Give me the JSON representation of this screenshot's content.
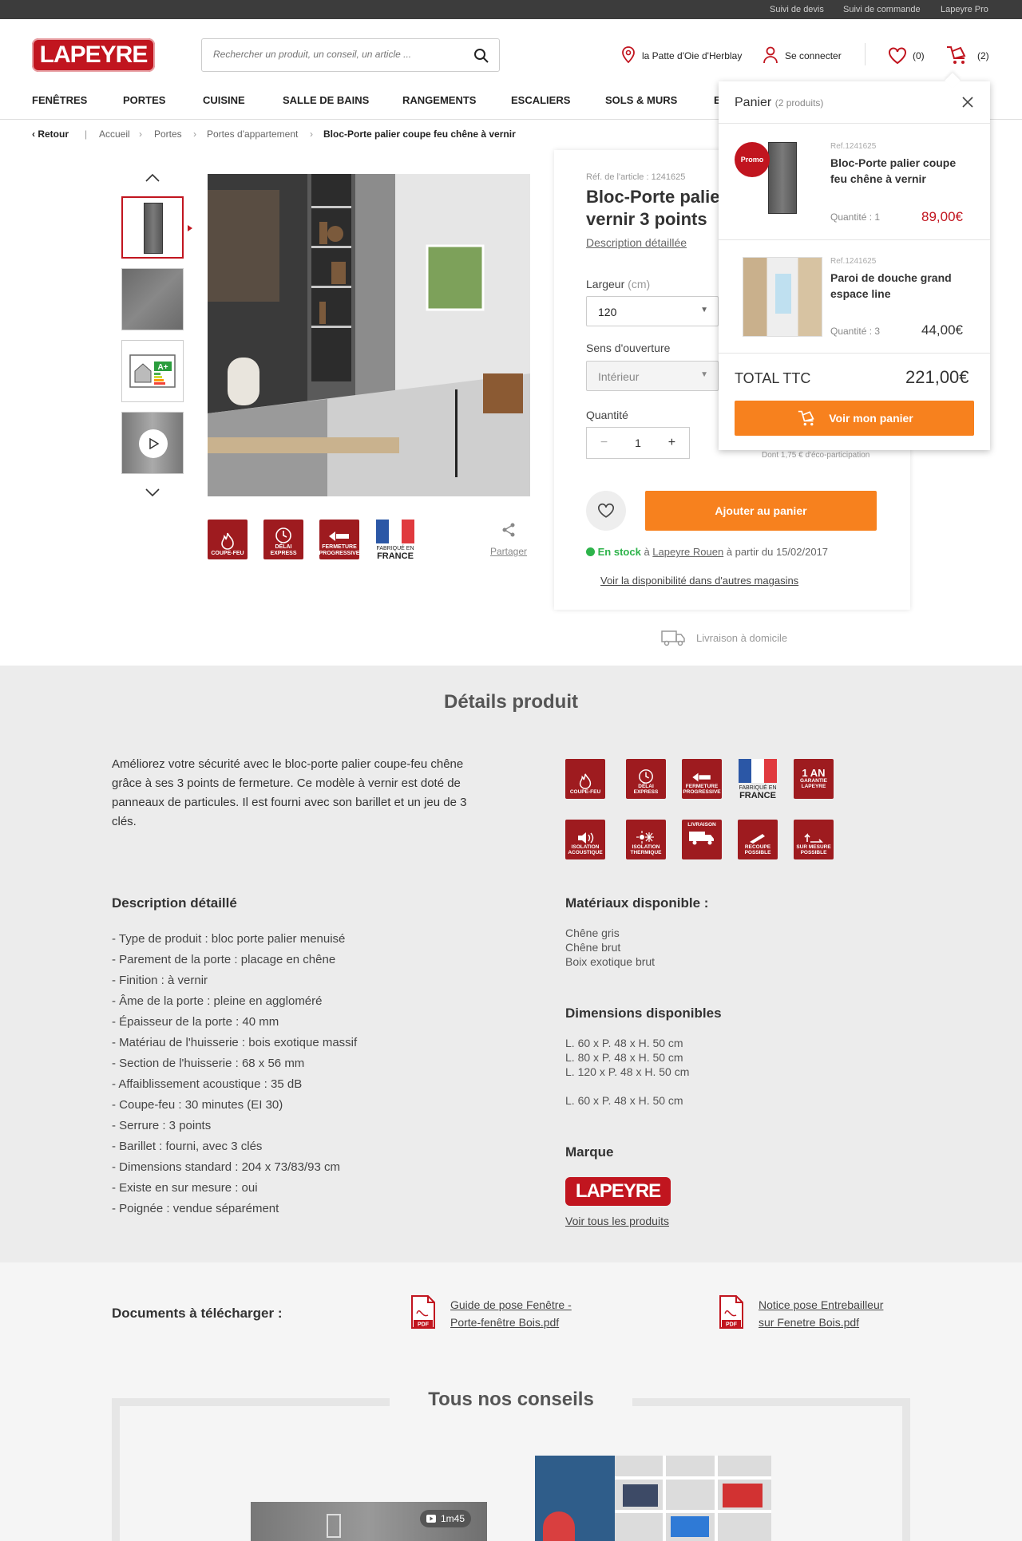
{
  "topbar": {
    "links": [
      "Suivi de devis",
      "Suivi de commande",
      "Lapeyre Pro"
    ]
  },
  "header": {
    "logo": "LAPEYRE",
    "search_placeholder": "Rechercher un produit, un conseil, un article ...",
    "store": "la Patte d'Oie d'Herblay",
    "login": "Se connecter",
    "wishlist_count": "(0)",
    "cart_count": "(2)"
  },
  "nav": [
    "FENÊTRES",
    "PORTES",
    "CUISINE",
    "SALLE DE BAINS",
    "RANGEMENTS",
    "ESCALIERS",
    "SOLS & MURS",
    "E"
  ],
  "breadcrumb": {
    "back": "Retour",
    "items": [
      "Accueil",
      "Portes",
      "Portes d'appartement"
    ],
    "current": "Bloc-Porte palier coupe feu chêne à vernir"
  },
  "product": {
    "ref": "Réf. de l'article : 1241625",
    "title_line1": "Bloc-Porte palier",
    "title_line2": "vernir 3 points",
    "desc_link": "Description détaillée",
    "largeur_label": "Largeur",
    "largeur_unit": "(cm)",
    "largeur_value": "120",
    "sens_label": "Sens d'ouverture",
    "sens_value": "Intérieur",
    "quantite_label": "Quantité",
    "quantite_value": "1",
    "eco": "Dont 1,75 € d'éco-participation",
    "add_to_cart": "Ajouter au panier",
    "stock_status": "En stock",
    "stock_at": "à",
    "stock_store": "Lapeyre Rouen",
    "stock_date": "à partir du 15/02/2017",
    "availability_link": "Voir la disponibilité dans d'autres magasins",
    "delivery": "Livraison à domicile",
    "share": "Partager",
    "badges": [
      {
        "l1": "COUPE-FEU",
        "l2": ""
      },
      {
        "l1": "DÉLAI",
        "l2": "EXPRESS"
      },
      {
        "l1": "FERMETURE",
        "l2": "PROGRESSIVE"
      },
      {
        "l1": "FABRIQUÉ EN",
        "l2": "FRANCE"
      }
    ]
  },
  "panier": {
    "title": "Panier",
    "count": "(2 produits)",
    "items": [
      {
        "promo": "Promo",
        "ref": "Ref.1241625",
        "name_l1": "Bloc-Porte palier coupe",
        "name_l2": "feu chêne à vernir",
        "qty": "Quantité : 1",
        "price": "89,00€"
      },
      {
        "ref": "Ref.1241625",
        "name_l1": "Paroi de douche grand",
        "name_l2": "espace line",
        "qty": "Quantité : 3",
        "price": "44,00€"
      }
    ],
    "total_label": "TOTAL TTC",
    "total_value": "221,00€",
    "button": "Voir mon panier"
  },
  "details": {
    "title": "Détails produit",
    "intro_l1": "Améliorez votre sécurité avec le bloc-porte palier coupe-feu chêne",
    "intro_l2": "grâce à ses 3 points de fermeture. Ce modèle à vernir est doté de",
    "intro_l3": "panneaux de particules. Il est fourni avec son barillet et un jeu de 3",
    "intro_l4": "clés.",
    "badges_row1": [
      {
        "l1": "COUPE-FEU",
        "l2": ""
      },
      {
        "l1": "DÉLAI",
        "l2": "EXPRESS"
      },
      {
        "l1": "FERMETURE",
        "l2": "PROGRESSIVE"
      },
      {
        "l1": "FABRIQUÉ EN",
        "l2": "FRANCE"
      },
      {
        "l1": "1 AN",
        "l2": "GARANTIE LAPEYRE"
      }
    ],
    "badges_row2": [
      {
        "l1": "ISOLATION",
        "l2": "ACOUSTIQUE"
      },
      {
        "l1": "ISOLATION",
        "l2": "THERMIQUE"
      },
      {
        "l1": "LIVRAISON",
        "l2": ""
      },
      {
        "l1": "RECOUPE",
        "l2": "POSSIBLE"
      },
      {
        "l1": "SUR MESURE",
        "l2": "POSSIBLE"
      }
    ],
    "desc_title": "Description détaillé",
    "desc_lines": [
      "- Type de produit : bloc porte palier menuisé",
      "- Parement de la porte : placage en chêne",
      "- Finition : à vernir",
      "- Âme de la porte : pleine en aggloméré",
      "- Épaisseur de la porte : 40 mm",
      "- Matériau de l'huisserie : bois exotique massif",
      "- Section de l'huisserie : 68 x 56 mm",
      "- Affaiblissement acoustique : 35 dB",
      "- Coupe-feu : 30 minutes (EI 30)",
      "- Serrure : 3 points",
      "- Barillet : fourni, avec 3 clés",
      "- Dimensions standard : 204 x 73/83/93 cm",
      "- Existe en sur mesure : oui",
      "- Poignée : vendue séparément"
    ],
    "materials_title": "Matériaux disponible :",
    "materials": [
      "Chêne gris",
      "Chêne brut",
      "Boix exotique brut"
    ],
    "dims_title": "Dimensions disponibles",
    "dims": [
      "L. 60 x P. 48 x H. 50 cm",
      "L. 80 x P. 48 x H. 50 cm",
      "L. 120 x P. 48 x H. 50 cm",
      "L. 60 x P. 48 x H. 50 cm"
    ],
    "brand_title": "Marque",
    "brand_logo": "LAPEYRE",
    "brand_link": "Voir tous les produits"
  },
  "documents": {
    "title": "Documents à télécharger :",
    "pdf_label": "PDF",
    "doc1_l1": "Guide de pose Fenêtre -",
    "doc1_l2": "Porte-fenêtre Bois.pdf",
    "doc2_l1": "Notice pose Entrebailleur",
    "doc2_l2": "sur Fenetre Bois.pdf"
  },
  "conseils": {
    "title": "Tous nos conseils",
    "video_duration": "1m45"
  },
  "colors": {
    "brand_red": "#c1151f",
    "orange": "#f7811e",
    "badge_red": "#9e1b1f",
    "stock_green": "#2db34a"
  }
}
